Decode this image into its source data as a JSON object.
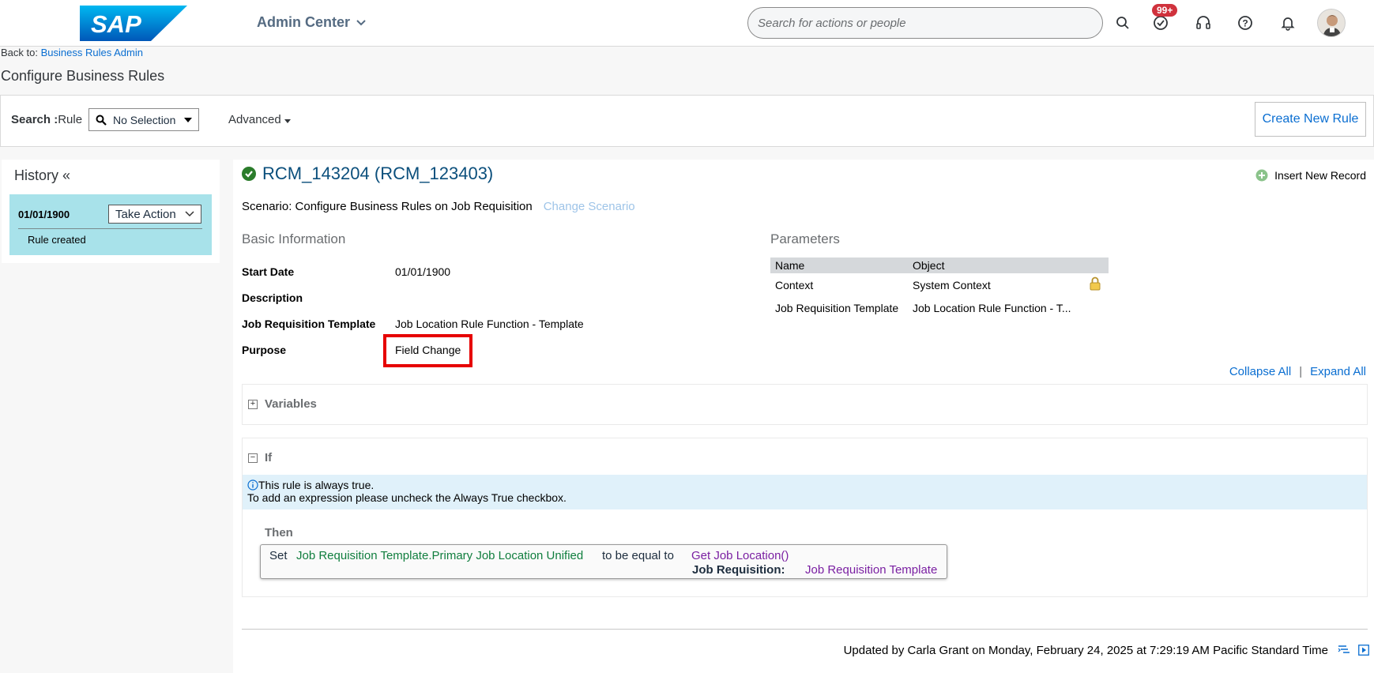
{
  "shell": {
    "logo_text": "SAP",
    "title": "Admin Center",
    "search_placeholder": "Search for actions or people",
    "badge_count": "99+"
  },
  "breadcrumb": {
    "prefix": "Back to:",
    "link": "Business Rules Admin"
  },
  "page_title": "Configure Business Rules",
  "searchbar": {
    "label_bold": "Search :",
    "label": "Rule",
    "select_value": "No Selection",
    "advanced": "Advanced",
    "create_button": "Create New Rule"
  },
  "history": {
    "title": "History «",
    "entry": {
      "date": "01/01/1900",
      "action": "Take Action",
      "note": "Rule created"
    }
  },
  "rule": {
    "title": "RCM_143204 (RCM_123403)",
    "insert_record": "Insert New Record",
    "scenario": "Scenario: Configure Business Rules on Job Requisition",
    "change_scenario": "Change Scenario"
  },
  "basic_info": {
    "heading": "Basic Information",
    "start_date_label": "Start Date",
    "start_date_value": "01/01/1900",
    "description_label": "Description",
    "template_label": "Job Requisition Template",
    "template_value": "Job Location Rule Function - Template",
    "purpose_label": "Purpose",
    "purpose_value": "Field Change"
  },
  "parameters": {
    "heading": "Parameters",
    "columns": [
      "Name",
      "Object"
    ],
    "rows": [
      {
        "name": "Context",
        "object": "System Context"
      },
      {
        "name": "Job Requisition Template",
        "object": "Job Location Rule Function - T..."
      }
    ]
  },
  "tree_controls": {
    "collapse_all": "Collapse All",
    "separator": "|",
    "expand_all": "Expand All"
  },
  "variables": {
    "label": "Variables",
    "toggle": "+"
  },
  "if_block": {
    "label": "If",
    "toggle": "−",
    "info_line1": "This rule is always true.",
    "info_line2": "To add an expression please uncheck the Always True checkbox.",
    "then_label": "Then",
    "set_word": "Set",
    "target_field": "Job Requisition Template.Primary Job Location Unified",
    "operator": "to be equal to",
    "function": "Get Job Location()",
    "param_label": "Job Requisition:",
    "param_value": "Job Requisition Template"
  },
  "footer": {
    "updated_text": "Updated by Carla Grant on Monday, February 24, 2025 at 7:29:19 AM Pacific Standard Time"
  },
  "colors": {
    "link": "#0a6ed1",
    "history_card": "#a8e2ea",
    "highlight_box": "#e60000",
    "green_field": "#107e3e",
    "purple_function": "#7a1fa2",
    "badge": "#d0323d"
  }
}
